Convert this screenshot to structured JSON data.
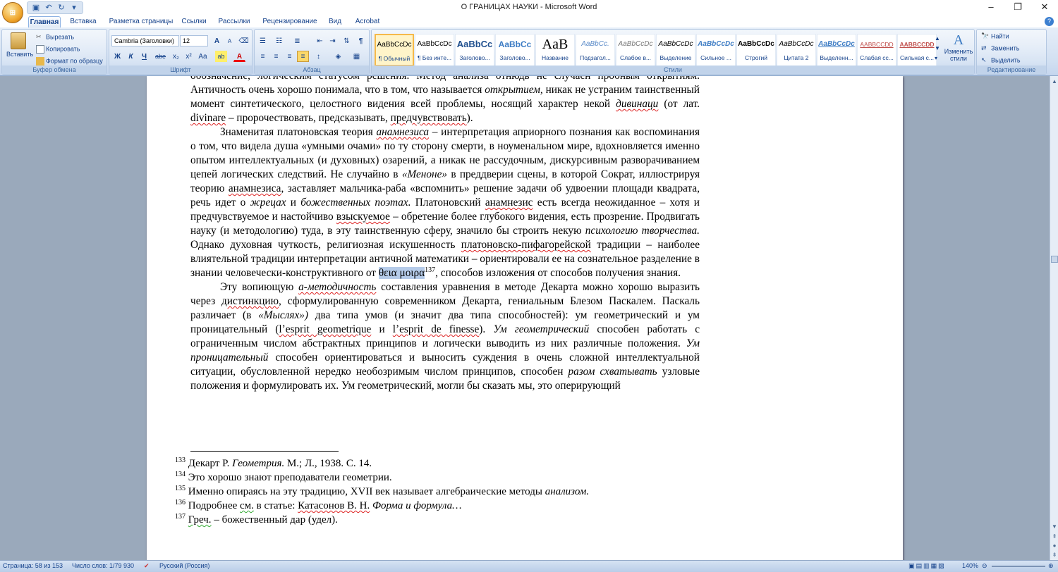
{
  "window": {
    "title": "О ГРАНИЦАХ НАУКИ - Microsoft Word"
  },
  "tabs": [
    "Главная",
    "Вставка",
    "Разметка страницы",
    "Ссылки",
    "Рассылки",
    "Рецензирование",
    "Вид",
    "Acrobat"
  ],
  "clipboard": {
    "paste": "Вставить",
    "cut": "Вырезать",
    "copy": "Копировать",
    "format_painter": "Формат по образцу",
    "label": "Буфер обмена"
  },
  "font": {
    "name": "Cambria (Заголовки)",
    "size": "12",
    "label": "Шрифт",
    "grow": "A",
    "shrink": "A",
    "bold": "Ж",
    "italic": "К",
    "underline": "Ч",
    "strike": "abe",
    "sub": "x₂",
    "sup": "x²",
    "case": "Aa"
  },
  "paragraph": {
    "label": "Абзац"
  },
  "styles": {
    "label": "Стили",
    "change": "Изменить стили",
    "items": [
      {
        "preview": "AaBbCcDc",
        "name": "¶ Обычный"
      },
      {
        "preview": "AaBbCcDc",
        "name": "¶ Без инте..."
      },
      {
        "preview": "AaBbCc",
        "name": "Заголово..."
      },
      {
        "preview": "AaBbCc",
        "name": "Заголово..."
      },
      {
        "preview": "AaB",
        "name": "Название"
      },
      {
        "preview": "AaBbCc.",
        "name": "Подзагол..."
      },
      {
        "preview": "AaBbCcDc",
        "name": "Слабое в..."
      },
      {
        "preview": "AaBbCcDc",
        "name": "Выделение"
      },
      {
        "preview": "AaBbCcDc",
        "name": "Сильное ..."
      },
      {
        "preview": "AaBbCcDc",
        "name": "Строгий"
      },
      {
        "preview": "AaBbCcDc",
        "name": "Цитата 2"
      },
      {
        "preview": "AaBbCcDc",
        "name": "Выделенн..."
      },
      {
        "preview": "AABBCCDD",
        "name": "Слабая сс..."
      },
      {
        "preview": "AABBCCDD",
        "name": "Сильная с..."
      }
    ]
  },
  "editing": {
    "find": "Найти",
    "replace": "Заменить",
    "select": "Выделить",
    "label": "Редактирование"
  },
  "doc": {
    "p0_top": "обозначение, логическим статусом решения. Метод анализа отнюдь не случаен пробным открытиям.",
    "p0_a": "Античность очень хорошо понимала, что в том, что называется ",
    "p0_b": "открытием,",
    "p0_c": " никак не устраним таинственный момент синтетического, целостного видения всей проблемы, носящий характер некой ",
    "p0_d": "дивинаци",
    "p0_e": " (от лат. ",
    "p0_f": "divinare",
    "p0_g": " – пророчествовать, предсказывать, ",
    "p0_h": "предчувствовать",
    "p0_i": ").",
    "p1_a": "Знаменитая платоновская теория ",
    "p1_b": "анамнезиса",
    "p1_c": " – интерпретация априорного познания как воспоминания о том, что видела душа «умными очами» по ту сторону смерти, в ноуменальном мире, вдохновляется именно опытом интеллектуальных (и духовных) озарений, а никак не рассудочным, дискурсивным разворачиванием цепей логических следствий. Не случайно в ",
    "p1_d": "«Меноне»",
    "p1_e": " в преддверии сцены, в которой Сократ, иллюстрируя теорию ",
    "p1_f": "анамнезиса",
    "p1_g": ", заставляет мальчика-раба «вспомнить» решение задачи об удвоении площади квадрата, речь идет о ",
    "p1_h": "жрецах",
    "p1_i": " и ",
    "p1_j": "божественных поэтах.",
    "p1_k": " Платоновский ",
    "p1_l": "анамнезис",
    "p1_m": " есть всегда неожиданное – хотя и предчувствуемое и настойчиво ",
    "p1_n": "взыскуемое",
    "p1_o": " – обретение более глубокого видения, есть прозрение. Продвигать науку (и методологию) туда, в эту таинственную сферу, значило бы строить некую ",
    "p1_p": "психологию творчества.",
    "p1_q": " Однако духовная чуткость, религиозная искушенность ",
    "p1_r": "платоновско-пифагорейской",
    "p1_s": " традиции – наиболее влиятельной традиции интерпретации античной математики – ориентировали ее на сознательное разделение в знании человечески-конструктивного от ",
    "p1_t": "θεια μοιρα",
    "p1_u": "137",
    "p1_v": ", способов изложения от способов получения знания.",
    "p2_a": "Эту вопиющую ",
    "p2_b": "а-методичность",
    "p2_c": " составления уравнения в методе Декарта можно хорошо выразить через ",
    "p2_d": "дистинкцию",
    "p2_e": ", сформулированную современником Декарта, гениальным Блезом Паскалем. Паскаль различает (в ",
    "p2_f": "«Мыслях»)",
    "p2_g": " два типа умов (и значит два типа способностей): ум геометрический и ум проницательный (",
    "p2_h": "l’esprit geometrique",
    "p2_i": " и ",
    "p2_j": "l’esprit de finesse",
    "p2_k": "). ",
    "p2_l": "Ум геометрический",
    "p2_m": " способен работать с ограниченным числом абстрактных принципов и логически выводить из них различные положения. ",
    "p2_n": "Ум проницательный",
    "p2_o": " способен ориентироваться и выносить суждения в очень сложной интеллектуальной ситуации, обусловленной нередко необозримым числом принципов, способен ",
    "p2_p": "разом схватывать",
    "p2_q": " узловые положения и формулировать их. Ум геометрический, могли бы сказать мы, это оперирующий"
  },
  "footnotes": [
    {
      "num": "133",
      "a": " Декарт Р. ",
      "b": "Геометрия.",
      "c": " М.; Л., 1938. С. 14."
    },
    {
      "num": "134",
      "a": " Это хорошо знают преподаватели геометрии.",
      "b": "",
      "c": ""
    },
    {
      "num": "135",
      "a": " Именно опираясь на эту традицию, XVII век называет алгебраические методы ",
      "b": "анализом.",
      "c": ""
    },
    {
      "num": "136",
      "a": " Подробнее ",
      "sq1": "см.",
      "a2": " в статье: ",
      "sq2": "Катасонов В. Н.",
      "b": " Форма и формула…",
      "c": ""
    },
    {
      "num": "137",
      "a": " ",
      "sq1": "Греч.",
      "a2": " – божественный дар (удел).",
      "b": "",
      "c": ""
    }
  ],
  "status": {
    "page": "Страница: 58 из 153",
    "words": "Число слов: 1/79 930",
    "lang": "Русский (Россия)",
    "zoom": "140%"
  }
}
